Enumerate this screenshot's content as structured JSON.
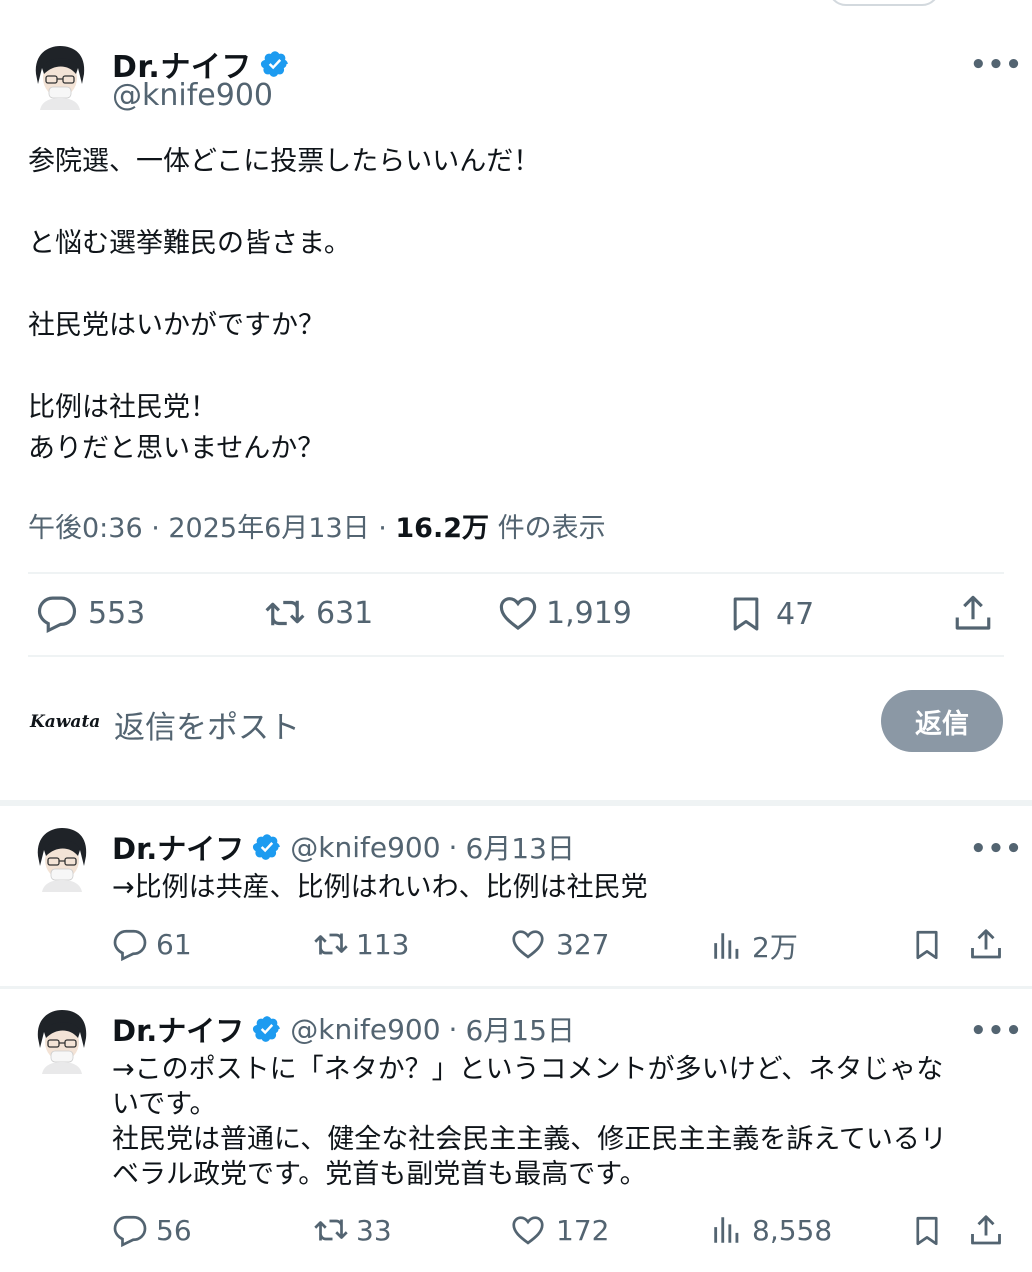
{
  "main_post": {
    "author_name": "Dr.ナイフ",
    "handle": "@knife900",
    "more": "•••",
    "body": "参院選、一体どこに投票したらいいんだ！\n\nと悩む選挙難民の皆さま。\n\n社民党はいかがですか？\n\n比例は社民党！\nありだと思いませんか？",
    "time": "午後0:36 · 2025年6月13日 · ",
    "views": "16.2万",
    "views_label": " 件の表示",
    "replies": "553",
    "reposts": "631",
    "likes": "1,919",
    "bookmarks": "47"
  },
  "reply_box": {
    "user_logo": "Kawata",
    "placeholder": "返信をポスト",
    "button": "返信"
  },
  "replies": [
    {
      "author_name": "Dr.ナイフ",
      "handle": "@knife900",
      "sep": "·",
      "date": "6月13日",
      "more": "•••",
      "text": "→比例は共産、比例はれいわ、比例は社民党",
      "replies": "61",
      "reposts": "113",
      "likes": "327",
      "views": "2万"
    },
    {
      "author_name": "Dr.ナイフ",
      "handle": "@knife900",
      "sep": "·",
      "date": "6月15日",
      "more": "•••",
      "text": "→このポストに「ネタか？」というコメントが多いけど、ネタじゃな\nいです。\n社民党は普通に、健全な社会民主主義、修正民主主義を訴えているリ\nベラル政党です。党首も副党首も最高です。",
      "replies": "56",
      "reposts": "33",
      "likes": "172",
      "views": "8,558"
    }
  ],
  "colors": {
    "verified": "#1d9bf0",
    "secondary_text": "#536471",
    "reply_button_disabled": "#8b98a5",
    "divider": "#eff3f4"
  },
  "icons": [
    "verified-badge-icon",
    "more-icon",
    "reply-icon",
    "repost-icon",
    "like-icon",
    "bookmark-icon",
    "share-icon",
    "views-icon"
  ]
}
